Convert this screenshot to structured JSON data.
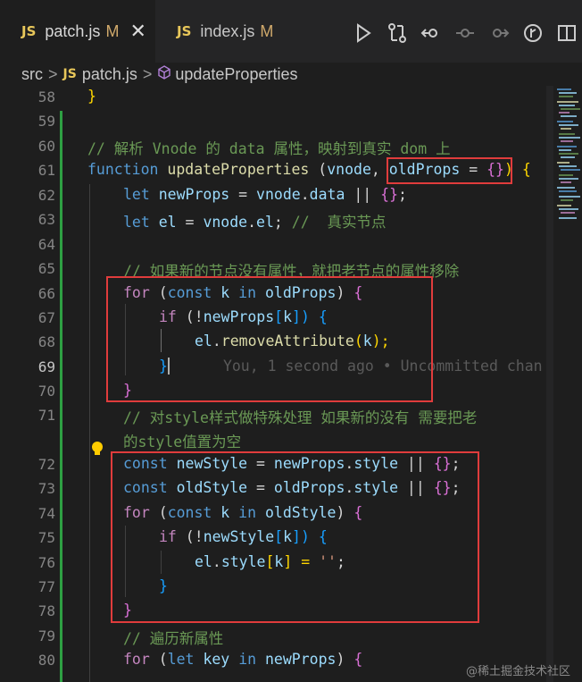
{
  "tabs": [
    {
      "icon": "JS",
      "name": "patch.js",
      "badge": "M",
      "close": "✕"
    },
    {
      "icon": "JS",
      "name": "index.js",
      "badge": "M"
    }
  ],
  "breadcrumb": {
    "folder": "src",
    "sep1": ">",
    "icon": "JS",
    "file": "patch.js",
    "sep2": ">",
    "symbol": "updateProperties"
  },
  "line_numbers": [
    "58",
    "59",
    "60",
    "61",
    "62",
    "63",
    "64",
    "65",
    "66",
    "67",
    "68",
    "69",
    "70",
    "71",
    "",
    "72",
    "73",
    "74",
    "75",
    "76",
    "77",
    "78",
    "79",
    "80"
  ],
  "code": {
    "l58": "}",
    "l60": "// 解析 Vnode 的 data 属性，映射到真实 dom 上",
    "l61_kw": "function",
    "l61_fn": "updateProperties",
    "l61_rest1": " (",
    "l61_p1": "vnode",
    "l61_rest2": ", ",
    "l61_p2": "oldProps",
    "l61_eq": " = ",
    "l61_obj": "{}",
    "l61_close": ")",
    "l61_brace": "{",
    "l62_kw": "let",
    "l62_a": "newProps",
    "l62_b": " = ",
    "l62_c": "vnode",
    "l62_d": ".",
    "l62_e": "data",
    "l62_f": " || ",
    "l62_g": "{}",
    "l62_h": ";",
    "l63_kw": "let",
    "l63_a": "el",
    "l63_b": " = ",
    "l63_c": "vnode",
    "l63_d": ".",
    "l63_e": "el",
    "l63_f": "; ",
    "l63_com": "//  真实节点",
    "l65": "// 如果新的节点没有属性，就把老节点的属性移除",
    "l66_kw": "for",
    "l66_a": " (",
    "l66_b": "const",
    "l66_c": "k",
    "l66_d": "in",
    "l66_e": "oldProps",
    "l66_f": ") ",
    "l66_g": "{",
    "l67_kw": "if",
    "l67_a": " (!",
    "l67_b": "newProps",
    "l67_c": "[",
    "l67_d": "k",
    "l67_e": "]) ",
    "l67_f": "{",
    "l68_a": "el",
    "l68_b": ".",
    "l68_c": "removeAttribute",
    "l68_d": "(",
    "l68_e": "k",
    "l68_f": ");",
    "l69": "}",
    "l69_blame": "You, 1 second ago • Uncommitted chan",
    "l70": "}",
    "l71a": "// 对style样式做特殊处理 如果新的没有 需要把老",
    "l71b": "的style值置为空",
    "l72_kw": "const",
    "l72_a": "newStyle",
    "l72_b": " = ",
    "l72_c": "newProps",
    "l72_d": ".",
    "l72_e": "style",
    "l72_f": " || ",
    "l72_g": "{}",
    "l72_h": ";",
    "l73_kw": "const",
    "l73_a": "oldStyle",
    "l73_b": " = ",
    "l73_c": "oldProps",
    "l73_d": ".",
    "l73_e": "style",
    "l73_f": " || ",
    "l73_g": "{}",
    "l73_h": ";",
    "l74_kw": "for",
    "l74_a": " (",
    "l74_b": "const",
    "l74_c": "k",
    "l74_d": "in",
    "l74_e": "oldStyle",
    "l74_f": ") ",
    "l74_g": "{",
    "l75_kw": "if",
    "l75_a": " (!",
    "l75_b": "newStyle",
    "l75_c": "[",
    "l75_d": "k",
    "l75_e": "]) ",
    "l75_f": "{",
    "l76_a": "el",
    "l76_b": ".",
    "l76_c": "style",
    "l76_d": "[",
    "l76_e": "k",
    "l76_f": "] = ",
    "l76_g": "''",
    "l76_h": ";",
    "l77": "}",
    "l78": "}",
    "l79": "// 遍历新属性",
    "l80_kw": "for",
    "l80_a": " (",
    "l80_b": "let",
    "l80_c": "key",
    "l80_d": "in",
    "l80_e": "newProps",
    "l80_f": ") ",
    "l80_g": "{"
  },
  "watermark": "@稀土掘金技术社区",
  "colors": {
    "highlight_box": "#e03c3c",
    "git_added": "#2ea043",
    "keyword": "#569cd6",
    "function": "#dcdcaa",
    "variable": "#9cdcfe",
    "comment": "#6a9955"
  }
}
